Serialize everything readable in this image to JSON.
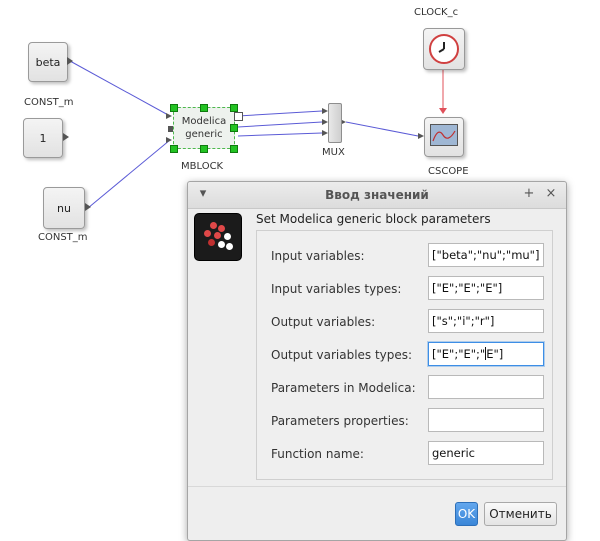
{
  "diagram": {
    "blocks": {
      "beta": {
        "label": "beta"
      },
      "one": {
        "label": "1"
      },
      "nu": {
        "label": "nu"
      }
    },
    "captions": {
      "const_top": "CONST_m",
      "const_bottom": "CONST_m",
      "mblock": "MBLOCK",
      "mux": "MUX",
      "clock": "CLOCK_c",
      "cscope": "CSCOPE"
    },
    "mblock": {
      "line1": "Modelica",
      "line2": "generic"
    },
    "colors": {
      "link": "#5b5bd6",
      "event_link": "#e0505a",
      "selection": "#22c322"
    }
  },
  "dialog": {
    "title": "Ввод значений",
    "pin_glyph": "+",
    "close_glyph": "×",
    "menu_glyph": "▾",
    "heading": "Set Modelica generic block parameters",
    "fields": [
      {
        "label": "Input variables:",
        "value": "[\"beta\";\"nu\";\"mu\"]"
      },
      {
        "label": "Input variables types:",
        "value": "[\"E\";\"E\";\"E\"]"
      },
      {
        "label": "Output variables:",
        "value": "[\"s\";\"i\";\"r\"]"
      },
      {
        "label": "Output variables types:",
        "value": "[\"E\";\"E\";\"",
        "value_after_caret": "E\"]"
      },
      {
        "label": "Parameters in Modelica:",
        "value": ""
      },
      {
        "label": "Parameters properties:",
        "value": ""
      },
      {
        "label": "Function name:",
        "value": "generic"
      }
    ],
    "buttons": {
      "ok": "OK",
      "cancel": "Отменить"
    },
    "accent": "#3a86d8"
  }
}
